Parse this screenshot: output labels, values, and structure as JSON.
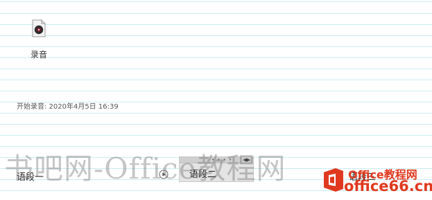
{
  "file": {
    "label": "录音",
    "icon": "audio-file-icon"
  },
  "recording": {
    "start_text": "开始录音: 2020年4月5日 16:39"
  },
  "segments": {
    "seg1": "语段一",
    "seg2": "语段二",
    "seg3": "语段三"
  },
  "watermark": {
    "text": "书吧网-Office教程网"
  },
  "logo": {
    "top_text_1": "Office",
    "top_text_2": "教程网",
    "bottom_text": "office66.cn"
  },
  "colors": {
    "line": "#c9ecf2",
    "logo": "#e0391f"
  }
}
